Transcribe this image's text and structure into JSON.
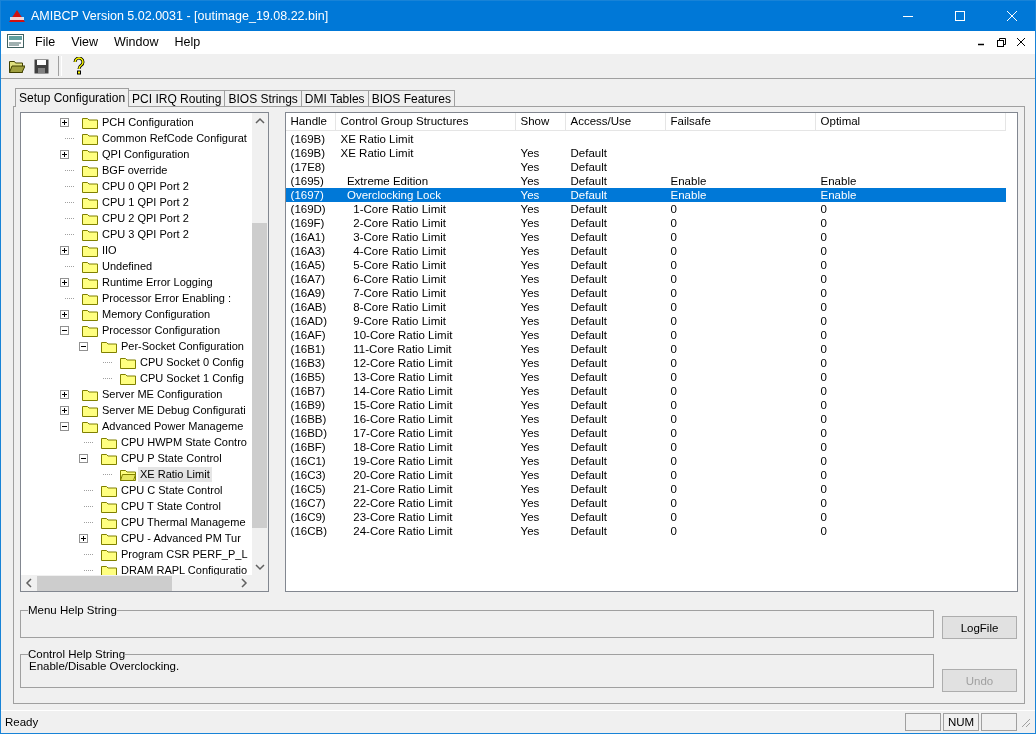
{
  "window": {
    "title": "AMIBCP Version 5.02.0031 - [outimage_19.08.22.bin]"
  },
  "menu": [
    "File",
    "View",
    "Window",
    "Help"
  ],
  "tabs": [
    {
      "label": "Setup Configuration",
      "selected": true
    },
    {
      "label": "PCI IRQ Routing",
      "selected": false
    },
    {
      "label": "BIOS Strings",
      "selected": false
    },
    {
      "label": "DMI Tables",
      "selected": false
    },
    {
      "label": "BIOS Features",
      "selected": false
    }
  ],
  "tree": {
    "items": [
      {
        "label": "PCH Configuration",
        "kind": "branch",
        "expanded": false,
        "selected": false
      },
      {
        "label": "Common RefCode Configurat",
        "kind": "leaf",
        "selected": false
      },
      {
        "label": "QPI Configuration",
        "kind": "branch",
        "expanded": false,
        "selected": false
      },
      {
        "label": "BGF override",
        "kind": "leaf",
        "selected": false
      },
      {
        "label": "CPU 0 QPI Port 2",
        "kind": "leaf",
        "selected": false
      },
      {
        "label": "CPU 1 QPI Port 2",
        "kind": "leaf",
        "selected": false
      },
      {
        "label": "CPU 2 QPI Port 2",
        "kind": "leaf",
        "selected": false
      },
      {
        "label": "CPU 3 QPI Port 2",
        "kind": "leaf",
        "selected": false
      },
      {
        "label": "IIO",
        "kind": "branch",
        "expanded": false,
        "selected": false
      },
      {
        "label": "Undefined",
        "kind": "leaf",
        "selected": false
      },
      {
        "label": "Runtime Error Logging",
        "kind": "branch",
        "expanded": false,
        "selected": false
      },
      {
        "label": "Processor Error Enabling :",
        "kind": "leaf",
        "selected": false
      },
      {
        "label": "Memory Configuration",
        "kind": "branch",
        "expanded": false,
        "selected": false
      },
      {
        "label": "Processor Configuration",
        "kind": "branch",
        "expanded": true,
        "selected": false,
        "children": [
          {
            "label": "Per-Socket Configuration",
            "kind": "branch",
            "expanded": true,
            "selected": false,
            "children": [
              {
                "label": "CPU Socket 0 Config",
                "kind": "leaf",
                "selected": false
              },
              {
                "label": "CPU Socket 1 Config",
                "kind": "leaf",
                "selected": false
              }
            ]
          }
        ]
      },
      {
        "label": "Server ME Configuration",
        "kind": "branch",
        "expanded": false,
        "selected": false
      },
      {
        "label": "Server ME Debug Configurati",
        "kind": "branch",
        "expanded": false,
        "selected": false
      },
      {
        "label": "Advanced Power Manageme",
        "kind": "branch",
        "expanded": true,
        "selected": false,
        "children": [
          {
            "label": "CPU HWPM State Contro",
            "kind": "leaf",
            "selected": false
          },
          {
            "label": "CPU P State Control",
            "kind": "branch",
            "expanded": true,
            "selected": false,
            "children": [
              {
                "label": "XE Ratio Limit",
                "kind": "leaf",
                "selected": true
              }
            ]
          },
          {
            "label": "CPU C State Control",
            "kind": "leaf",
            "selected": false
          },
          {
            "label": "CPU T State Control",
            "kind": "leaf",
            "selected": false
          },
          {
            "label": "CPU Thermal Manageme",
            "kind": "leaf",
            "selected": false
          },
          {
            "label": "CPU - Advanced PM Tur",
            "kind": "branch",
            "expanded": false,
            "selected": false
          },
          {
            "label": "Program CSR PERF_P_L",
            "kind": "leaf",
            "selected": false
          },
          {
            "label": "DRAM RAPL Configuratio",
            "kind": "leaf",
            "selected": false
          }
        ]
      }
    ]
  },
  "table": {
    "columns": [
      "Handle",
      "Control Group Structures",
      "Show",
      "Access/Use",
      "Failsafe",
      "Optimal"
    ],
    "rows": [
      {
        "cells": [
          "(169B)",
          "XE Ratio Limit",
          "",
          "",
          "",
          ""
        ],
        "selected": false
      },
      {
        "cells": [
          "(169B)",
          "XE Ratio Limit",
          "Yes",
          "Default",
          "",
          ""
        ],
        "selected": false
      },
      {
        "cells": [
          "(17E8)",
          "",
          "Yes",
          "Default",
          "",
          ""
        ],
        "selected": false
      },
      {
        "cells": [
          "(1695)",
          "  Extreme Edition",
          "Yes",
          "Default",
          "Enable",
          "Enable"
        ],
        "selected": false
      },
      {
        "cells": [
          "(1697)",
          "  Overclocking Lock",
          "Yes",
          "Default",
          "Enable",
          "Enable"
        ],
        "selected": true
      },
      {
        "cells": [
          "(169D)",
          "    1-Core Ratio Limit",
          "Yes",
          "Default",
          "0",
          "0"
        ],
        "selected": false
      },
      {
        "cells": [
          "(169F)",
          "    2-Core Ratio Limit",
          "Yes",
          "Default",
          "0",
          "0"
        ],
        "selected": false
      },
      {
        "cells": [
          "(16A1)",
          "    3-Core Ratio Limit",
          "Yes",
          "Default",
          "0",
          "0"
        ],
        "selected": false
      },
      {
        "cells": [
          "(16A3)",
          "    4-Core Ratio Limit",
          "Yes",
          "Default",
          "0",
          "0"
        ],
        "selected": false
      },
      {
        "cells": [
          "(16A5)",
          "    5-Core Ratio Limit",
          "Yes",
          "Default",
          "0",
          "0"
        ],
        "selected": false
      },
      {
        "cells": [
          "(16A7)",
          "    6-Core Ratio Limit",
          "Yes",
          "Default",
          "0",
          "0"
        ],
        "selected": false
      },
      {
        "cells": [
          "(16A9)",
          "    7-Core Ratio Limit",
          "Yes",
          "Default",
          "0",
          "0"
        ],
        "selected": false
      },
      {
        "cells": [
          "(16AB)",
          "    8-Core Ratio Limit",
          "Yes",
          "Default",
          "0",
          "0"
        ],
        "selected": false
      },
      {
        "cells": [
          "(16AD)",
          "    9-Core Ratio Limit",
          "Yes",
          "Default",
          "0",
          "0"
        ],
        "selected": false
      },
      {
        "cells": [
          "(16AF)",
          "    10-Core Ratio Limit",
          "Yes",
          "Default",
          "0",
          "0"
        ],
        "selected": false
      },
      {
        "cells": [
          "(16B1)",
          "    11-Core Ratio Limit",
          "Yes",
          "Default",
          "0",
          "0"
        ],
        "selected": false
      },
      {
        "cells": [
          "(16B3)",
          "    12-Core Ratio Limit",
          "Yes",
          "Default",
          "0",
          "0"
        ],
        "selected": false
      },
      {
        "cells": [
          "(16B5)",
          "    13-Core Ratio Limit",
          "Yes",
          "Default",
          "0",
          "0"
        ],
        "selected": false
      },
      {
        "cells": [
          "(16B7)",
          "    14-Core Ratio Limit",
          "Yes",
          "Default",
          "0",
          "0"
        ],
        "selected": false
      },
      {
        "cells": [
          "(16B9)",
          "    15-Core Ratio Limit",
          "Yes",
          "Default",
          "0",
          "0"
        ],
        "selected": false
      },
      {
        "cells": [
          "(16BB)",
          "    16-Core Ratio Limit",
          "Yes",
          "Default",
          "0",
          "0"
        ],
        "selected": false
      },
      {
        "cells": [
          "(16BD)",
          "    17-Core Ratio Limit",
          "Yes",
          "Default",
          "0",
          "0"
        ],
        "selected": false
      },
      {
        "cells": [
          "(16BF)",
          "    18-Core Ratio Limit",
          "Yes",
          "Default",
          "0",
          "0"
        ],
        "selected": false
      },
      {
        "cells": [
          "(16C1)",
          "    19-Core Ratio Limit",
          "Yes",
          "Default",
          "0",
          "0"
        ],
        "selected": false
      },
      {
        "cells": [
          "(16C3)",
          "    20-Core Ratio Limit",
          "Yes",
          "Default",
          "0",
          "0"
        ],
        "selected": false
      },
      {
        "cells": [
          "(16C5)",
          "    21-Core Ratio Limit",
          "Yes",
          "Default",
          "0",
          "0"
        ],
        "selected": false
      },
      {
        "cells": [
          "(16C7)",
          "    22-Core Ratio Limit",
          "Yes",
          "Default",
          "0",
          "0"
        ],
        "selected": false
      },
      {
        "cells": [
          "(16C9)",
          "    23-Core Ratio Limit",
          "Yes",
          "Default",
          "0",
          "0"
        ],
        "selected": false
      },
      {
        "cells": [
          "(16CB)",
          "    24-Core Ratio Limit",
          "Yes",
          "Default",
          "0",
          "0"
        ],
        "selected": false
      }
    ]
  },
  "menu_help": {
    "label": "Menu Help String"
  },
  "control_help": {
    "label": "Control Help String",
    "text": "Enable/Disable Overclocking."
  },
  "buttons": [
    {
      "label": "LogFile",
      "disabled": false
    },
    {
      "label": "Undo",
      "disabled": true
    }
  ],
  "status_bar": {
    "text": "Ready",
    "indicators": [
      "NUM"
    ]
  }
}
